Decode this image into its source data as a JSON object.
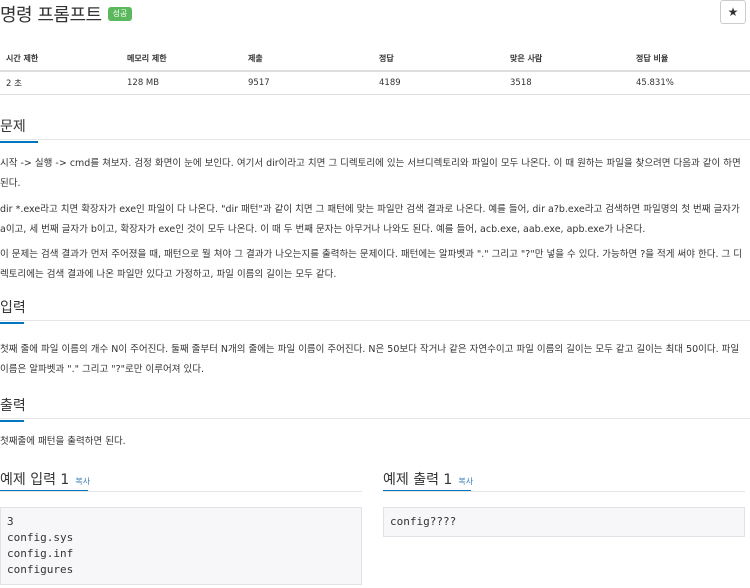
{
  "problem": {
    "title": "명령 프롬프트",
    "badge": "성공",
    "star_icon": "★"
  },
  "info_table": {
    "headers": [
      "시간 제한",
      "메모리 제한",
      "제출",
      "정답",
      "맞은 사람",
      "정답 비율"
    ],
    "values": [
      "2 초",
      "128 MB",
      "9517",
      "4189",
      "3518",
      "45.831%"
    ]
  },
  "sections": {
    "problem_heading": "문제",
    "problem_p1": "시작 -> 실행 -> cmd를 쳐보자. 검정 화면이 눈에 보인다. 여기서 dir이라고 치면 그 디렉토리에 있는 서브디렉토리와 파일이 모두 나온다. 이 때 원하는 파일을 찾으려면 다음과 같이 하면 된다.",
    "problem_p2": "dir *.exe라고 치면 확장자가 exe인 파일이 다 나온다. \"dir 패턴\"과 같이 치면 그 패턴에 맞는 파일만 검색 결과로 나온다. 예를 들어, dir a?b.exe라고 검색하면 파일명의 첫 번째 글자가 a이고, 세 번째 글자가 b이고, 확장자가 exe인 것이 모두 나온다. 이 때 두 번째 문자는 아무거나 나와도 된다. 예를 들어, acb.exe, aab.exe, apb.exe가 나온다.",
    "problem_p3": "이 문제는 검색 결과가 먼저 주어졌을 때, 패턴으로 뭘 쳐야 그 결과가 나오는지를 출력하는 문제이다. 패턴에는 알파벳과 \".\" 그리고 \"?\"만 넣을 수 있다. 가능하면 ?을 적게 써야 한다. 그 디렉토리에는 검색 결과에 나온 파일만 있다고 가정하고, 파일 이름의 길이는 모두 같다.",
    "input_heading": "입력",
    "input_p": "첫째 줄에 파일 이름의 개수 N이 주어진다. 둘째 줄부터 N개의 줄에는 파일 이름이 주어진다. N은 50보다 작거나 같은 자연수이고 파일 이름의 길이는 모두 같고 길이는 최대 50이다. 파일이름은 알파벳과 \".\" 그리고 \"?\"로만 이루어져 있다.",
    "output_heading": "출력",
    "output_p": "첫째줄에 패턴을 출력하면 된다."
  },
  "samples": {
    "input_heading": "예제 입력 1",
    "output_heading": "예제 출력 1",
    "copy_label": "복사",
    "input_text": "3\nconfig.sys\nconfig.inf\nconfigures",
    "output_text": "config????"
  }
}
